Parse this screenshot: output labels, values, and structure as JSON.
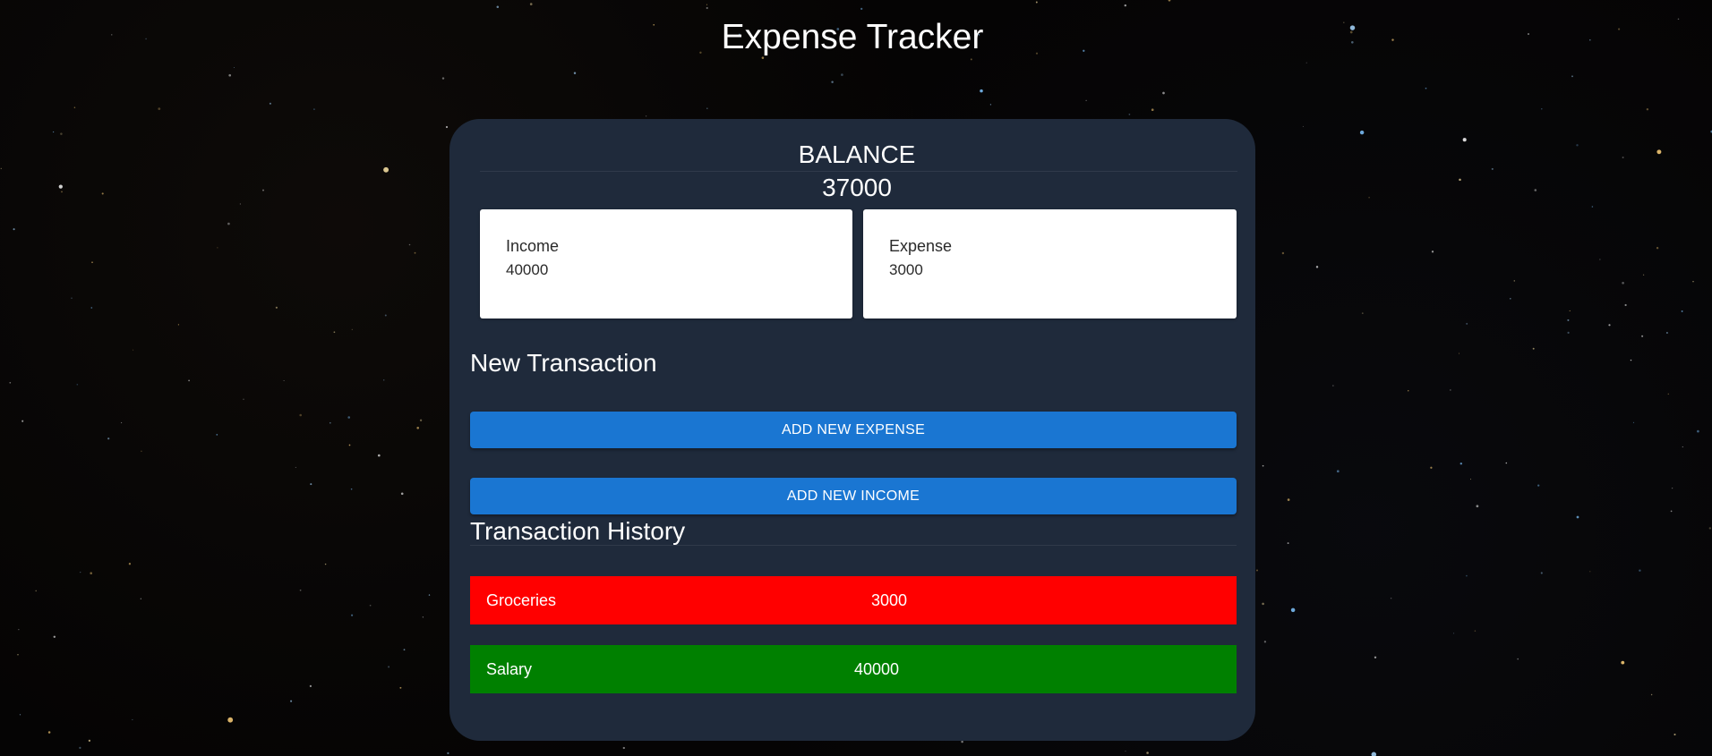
{
  "app": {
    "title": "Expense Tracker"
  },
  "balance": {
    "label": "BALANCE",
    "value": "37000"
  },
  "summary": {
    "income": {
      "label": "Income",
      "value": "40000"
    },
    "expense": {
      "label": "Expense",
      "value": "3000"
    }
  },
  "new_transaction": {
    "heading": "New Transaction",
    "add_expense_label": "ADD NEW EXPENSE",
    "add_income_label": "ADD NEW INCOME"
  },
  "history": {
    "heading": "Transaction History",
    "items": [
      {
        "name": "Groceries",
        "amount": "3000",
        "type": "expense"
      },
      {
        "name": "Salary",
        "amount": "40000",
        "type": "income"
      }
    ]
  },
  "colors": {
    "panel": "#1f2a3b",
    "button": "#1a76d2",
    "expense_row": "#ff0000",
    "income_row": "#008000",
    "background": "#050404"
  }
}
